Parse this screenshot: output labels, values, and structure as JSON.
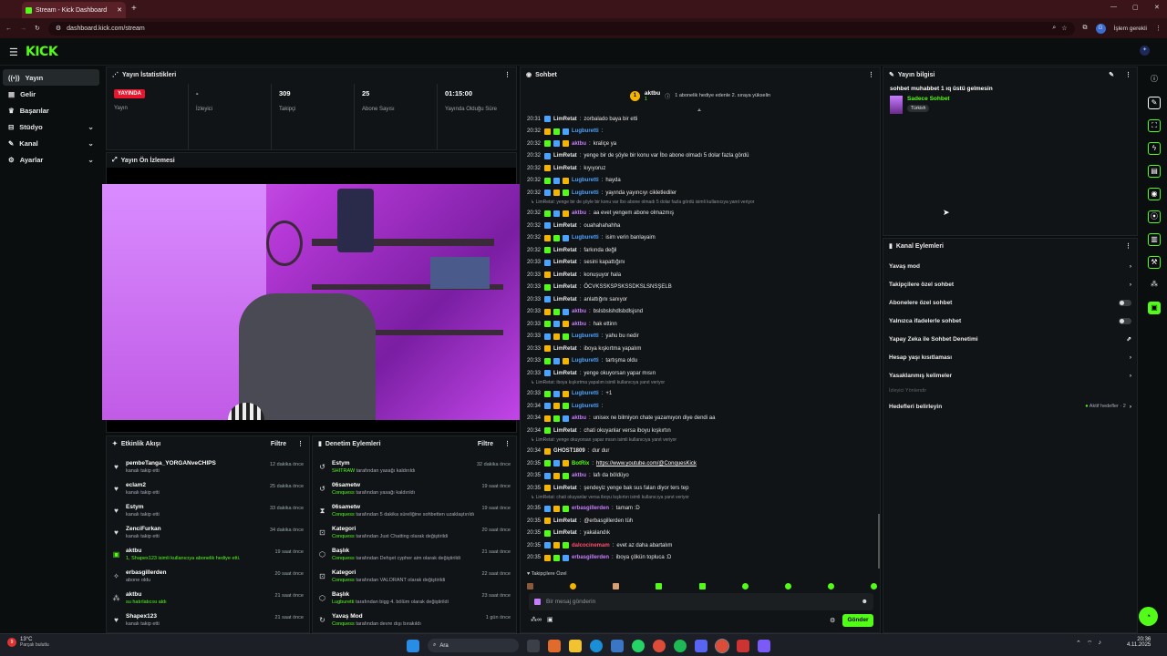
{
  "browser": {
    "tab_title": "Stream - Kick Dashboard",
    "url": "dashboard.kick.com/stream",
    "profile_initial": "G",
    "pending_label": "İşlem gerekli"
  },
  "brand": {
    "logo": "KICK",
    "accent": "#53fc18"
  },
  "sidebar": {
    "items": [
      {
        "label": "Yayın",
        "icon": "broadcast-icon"
      },
      {
        "label": "Gelir",
        "icon": "revenue-icon"
      },
      {
        "label": "Başarılar",
        "icon": "trophy-icon"
      },
      {
        "label": "Stüdyo",
        "icon": "studio-icon"
      },
      {
        "label": "Kanal",
        "icon": "channel-icon"
      },
      {
        "label": "Ayarlar",
        "icon": "settings-icon"
      }
    ]
  },
  "stats": {
    "title": "Yayın İstatistikleri",
    "status_value": "YAYINDA",
    "status_label": "Yayın",
    "viewers_value": "-",
    "viewers_label": "İzleyici",
    "followers_value": "309",
    "followers_label": "Takipçi",
    "subs_value": "25",
    "subs_label": "Abone Sayısı",
    "uptime_value": "01:15:00",
    "uptime_label": "Yayında Olduğu Süre"
  },
  "preview": {
    "title": "Yayın Ön İzlemesi"
  },
  "activity": {
    "title": "Etkinlik Akışı",
    "filter": "Filtre",
    "items": [
      {
        "name": "pembeTanga_YORGANveCHIPS",
        "sub": "kanalı takip etti",
        "time": "12 dakika önce"
      },
      {
        "name": "eclam2",
        "sub": "kanalı takip etti",
        "time": "25 dakika önce"
      },
      {
        "name": "Estym",
        "sub": "kanalı takip etti",
        "time": "33 dakika önce"
      },
      {
        "name": "ZenciFurkan",
        "sub": "kanalı takip etti",
        "time": "34 dakika önce"
      },
      {
        "name": "aktbu",
        "sub": "1, Shapex123 isimli kullanıcıya abonelik hediye etti.",
        "time": "19 saat önce"
      },
      {
        "name": "erbasgillerden",
        "sub": "abone oldu",
        "time": "20 saat önce"
      },
      {
        "name": "aktbu",
        "sub": "su hatırlatıcısı aldı",
        "time": "21 saat önce"
      },
      {
        "name": "Shapex123",
        "sub": "kanalı takip etti",
        "time": "21 saat önce"
      }
    ]
  },
  "moderation": {
    "title": "Denetim Eylemleri",
    "filter": "Filtre",
    "items": [
      {
        "name": "Estym",
        "who": "SHITRAW",
        "sub": "tarafından yasağı kaldırıldı",
        "time": "32 dakika önce"
      },
      {
        "name": "06sametw",
        "who": "Conquess",
        "sub": "tarafından yasağı kaldırıldı",
        "time": "19 saat önce"
      },
      {
        "name": "06sametw",
        "who": "Conquess",
        "sub": "tarafından 5 dakika süreliğine sohbetten uzaklaştırıldı",
        "time": "19 saat önce"
      },
      {
        "name": "Kategori",
        "who": "Conquess",
        "sub": "tarafından Just Chatting olarak değiştirildi",
        "time": "20 saat önce"
      },
      {
        "name": "Başlık",
        "who": "Conquess",
        "sub": "tarafından Dehşet cypher aim olarak değiştirildi",
        "time": "21 saat önce"
      },
      {
        "name": "Kategori",
        "who": "Conquess",
        "sub": "tarafından VALORANT olarak değiştirildi",
        "time": "22 saat önce"
      },
      {
        "name": "Başlık",
        "who": "Lugburetti",
        "sub": "tarafından bigg 4. bölüm olarak değiştirildi",
        "time": "23 saat önce"
      },
      {
        "name": "Yavaş Mod",
        "who": "Conquess",
        "sub": "tarafından devre dışı bırakıldı",
        "time": "1 gün önce"
      }
    ]
  },
  "chat": {
    "title": "Sohbet",
    "pinned_user": "aktbu",
    "pinned_count": "1",
    "pinned_text": "1 abonelik hediye edenle 2. sıraya yükselin",
    "messages": [
      {
        "t": "20:31",
        "u": "LimRetat",
        "c": "zorbalado baya bir etti",
        "col": "#e6e6e6"
      },
      {
        "t": "20:32",
        "u": "Lugburetti",
        "c": "",
        "col": "#4aa3ff"
      },
      {
        "t": "20:32",
        "u": "aktbu",
        "c": "kraliçe ya",
        "col": "#c77dff"
      },
      {
        "t": "20:32",
        "u": "LimRetat",
        "c": "yenge bir de şöyle bir konu var İbo abone olmadı 5 dolar fazla gördü",
        "col": "#e6e6e6"
      },
      {
        "t": "20:32",
        "u": "LimRetat",
        "c": "kıyıyoruz",
        "col": "#e6e6e6"
      },
      {
        "t": "20:32",
        "u": "Lugburetti",
        "c": "hayda",
        "col": "#4aa3ff"
      },
      {
        "t": "20:32",
        "u": "Lugburetti",
        "c": "yayında yayıncıyı cikletlediler",
        "col": "#4aa3ff"
      },
      {
        "sys": "↳ LimRetat: yenge bir de şöyle bir konu var İbo abone olmadı 5 dolar fazla gördü isimli kullanıcıya yanıt veriyor"
      },
      {
        "t": "20:32",
        "u": "aktbu",
        "c": "aa evet yengem abone olmazmış",
        "col": "#c77dff"
      },
      {
        "t": "20:32",
        "u": "LimRetat",
        "c": "ouahahahahha",
        "col": "#e6e6e6"
      },
      {
        "t": "20:32",
        "u": "Lugburetti",
        "c": "isim verin banlayaim",
        "col": "#4aa3ff"
      },
      {
        "t": "20:32",
        "u": "LimRetat",
        "c": "farkında değil",
        "col": "#e6e6e6"
      },
      {
        "t": "20:33",
        "u": "LimRetat",
        "c": "sesini kapattığını",
        "col": "#e6e6e6"
      },
      {
        "t": "20:33",
        "u": "LimRetat",
        "c": "konuşuyor hala",
        "col": "#e6e6e6"
      },
      {
        "t": "20:33",
        "u": "LimRetat",
        "c": "ÖCVKSSKSPSKSSDKSLSNSŞELB",
        "col": "#e6e6e6"
      },
      {
        "t": "20:33",
        "u": "LimRetat",
        "c": "anlattığını sanıyor",
        "col": "#e6e6e6"
      },
      {
        "t": "20:33",
        "u": "aktbu",
        "c": "bslsbslshdlsbdlsjsnd",
        "col": "#c77dff"
      },
      {
        "t": "20:33",
        "u": "aktbu",
        "c": "hak ettinn",
        "col": "#c77dff"
      },
      {
        "t": "20:33",
        "u": "Lugburetti",
        "c": "yahu bu nedir",
        "col": "#4aa3ff"
      },
      {
        "t": "20:33",
        "u": "LimRetat",
        "c": "iboya kışkırtma yapalım",
        "col": "#e6e6e6"
      },
      {
        "t": "20:33",
        "u": "Lugburetti",
        "c": "tartışma oldu",
        "col": "#4aa3ff"
      },
      {
        "t": "20:33",
        "u": "LimRetat",
        "c": "yenge okuyorsan yapar mısın",
        "col": "#e6e6e6"
      },
      {
        "sys": "↳ LimRetat: iboya kışkırtma yapalım isimli kullanıcıya yanıt veriyor"
      },
      {
        "t": "20:33",
        "u": "Lugburetti",
        "c": "+1",
        "col": "#4aa3ff"
      },
      {
        "t": "20:34",
        "u": "Lugburetti",
        "c": "",
        "col": "#4aa3ff"
      },
      {
        "t": "20:34",
        "u": "aktbu",
        "c": "unisex ne bilmiyon chate yazamıyon diye dendi aa",
        "col": "#c77dff"
      },
      {
        "t": "20:34",
        "u": "LimRetat",
        "c": "chati okuyanlar versa iboyu kışkırtın",
        "col": "#e6e6e6"
      },
      {
        "sys": "↳ LimRetat: yenge okuyorsan yapar mısın isimli kullanıcıya yanıt veriyor"
      },
      {
        "t": "20:34",
        "u": "GHOST1809",
        "c": "dur dur",
        "col": "#e6e6e6"
      },
      {
        "t": "20:35",
        "u": "BotRix",
        "c": "https://www.youtube.com/@ConquesKick",
        "col": "#53fc18"
      },
      {
        "t": "20:35",
        "u": "aktbu",
        "c": "lafı da böldüyo",
        "col": "#c77dff"
      },
      {
        "t": "20:35",
        "u": "LimRetat",
        "c": "şendeyiz yenge bak sus falan diyor ters tep",
        "col": "#e6e6e6"
      },
      {
        "sys": "↳ LimRetat: chati okuyanlar versa iboyu kışkırtın isimli kullanıcıya yanıt veriyor"
      },
      {
        "t": "20:35",
        "u": "erbasgillerden",
        "c": "tamam :D",
        "col": "#c77dff"
      },
      {
        "t": "20:35",
        "u": "LimRetat",
        "c": "@erbasgillerden tüh",
        "col": "#e6e6e6"
      },
      {
        "t": "20:35",
        "u": "LimRetat",
        "c": "yakalandık",
        "col": "#e6e6e6"
      },
      {
        "t": "20:35",
        "u": "dalcocinemam",
        "c": "evet az daha abartalım",
        "col": "#ff4d6d"
      },
      {
        "t": "20:35",
        "u": "erbasgillerden",
        "c": "iboya çökün topluca :D",
        "col": "#c77dff"
      },
      {
        "t": "20:35",
        "u": "LimRetat",
        "c": "yapın yapın lütfen",
        "col": "#e6e6e6"
      }
    ],
    "followers_only_label": "Takipçilere Özel",
    "input_placeholder": "Bir mesaj gönderin",
    "send_label": "Gönder"
  },
  "stream_info": {
    "title_label": "Yayın bilgisi",
    "stream_title": "sohbet muhabbet 1 ıq üstü gelmesin",
    "category": "Sadece Sohbet",
    "language": "Türkish"
  },
  "channel_actions": {
    "title": "Kanal Eylemleri",
    "items": [
      {
        "label": "Yavaş mod",
        "kind": "chevron"
      },
      {
        "label": "Takipçilere özel sohbet",
        "kind": "chevron"
      },
      {
        "label": "Abonelere özel sohbet",
        "kind": "toggle"
      },
      {
        "label": "Yalnızca ifadelerle sohbet",
        "kind": "toggle"
      },
      {
        "label": "Yapay Zeka ile Sohbet Denetimi",
        "kind": "external"
      },
      {
        "label": "Hesap yaşı kısıtlaması",
        "kind": "chevron"
      },
      {
        "label": "Yasaklanmış kelimeler",
        "kind": "chevron"
      }
    ],
    "section_label": "İzleyici Yönlendir",
    "goals_label": "Hedefleri belirleyin",
    "goals_status": "Aktif hedefler · 2"
  },
  "taskbar": {
    "weather_temp": "13°C",
    "weather_text": "Parçalı bulutlu",
    "weather_badge": "9",
    "search_placeholder": "Ara",
    "time": "20:36",
    "date": "4.11.2025"
  }
}
